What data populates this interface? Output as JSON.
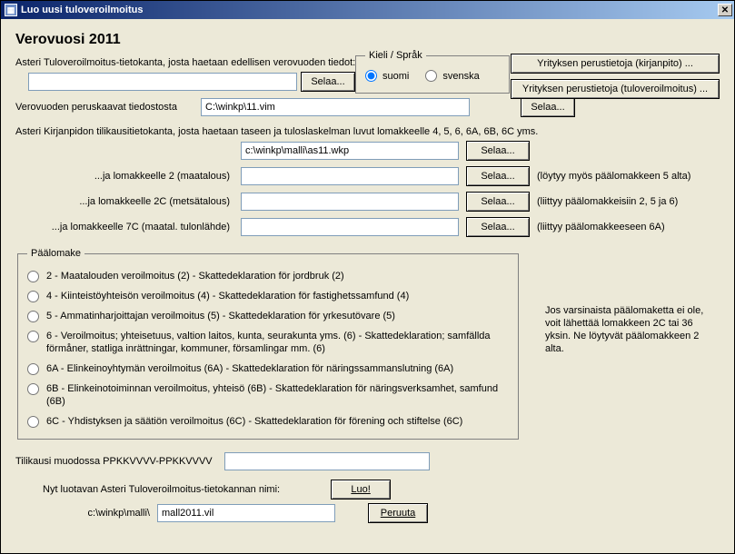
{
  "window": {
    "title": "Luo uusi tuloveroilmoitus"
  },
  "heading": "Verovuosi 2011",
  "buttons": {
    "company_kirjanpito": "Yrityksen perustietoja (kirjanpito) ...",
    "company_tulovero": "Yrityksen perustietoja (tuloveroilmoitus) ...",
    "browse": "Selaa...",
    "create": "Luo!",
    "cancel": "Peruuta"
  },
  "lang": {
    "legend": "Kieli / Språk",
    "fi": "suomi",
    "sv": "svenska"
  },
  "db": {
    "prev_label": "Asteri Tuloveroilmoitus-tietokanta, josta haetaan edellisen verovuoden tiedot:",
    "prev_value": "",
    "formulas_label": "Verovuoden peruskaavat tiedostosta",
    "formulas_value": "C:\\winkp\\11.vim",
    "kirjanpito_label": "Asteri Kirjanpidon tilikausitietokanta, josta haetaan taseen ja tuloslaskelman luvut lomakkeelle 4, 5, 6, 6A, 6B, 6C yms.",
    "kirjanpito_value": "c:\\winkp\\malli\\as11.wkp",
    "f2_label": "...ja lomakkeelle 2 (maatalous)",
    "f2_value": "",
    "f2_hint": "(löytyy myös päälomakkeen 5 alta)",
    "f2c_label": "...ja lomakkeelle 2C (metsätalous)",
    "f2c_value": "",
    "f2c_hint": "(liittyy päälomakkeisiin 2, 5 ja 6)",
    "f7c_label": "...ja lomakkeelle 7C (maatal. tulonlähde)",
    "f7c_value": "",
    "f7c_hint": "(liittyy päälomakkeeseen 6A)"
  },
  "mainform": {
    "legend": "Päälomake",
    "options": {
      "o2": "2 - Maatalouden veroilmoitus (2) - Skattedeklaration för jordbruk (2)",
      "o4": "4 - Kiinteistöyhteisön veroilmoitus (4) - Skattedeklaration för fastighetssamfund (4)",
      "o5": "5 - Ammatinharjoittajan veroilmoitus (5) - Skattedeklaration för yrkesutövare (5)",
      "o6": "6 - Veroilmoitus; yhteisetuus, valtion laitos, kunta, seurakunta yms. (6) - Skattedeklaration; samfällda förmåner, statliga inrättningar, kommuner, församlingar mm. (6)",
      "o6a": "6A - Elinkeinoyhtymän veroilmoitus (6A) - Skattedeklaration för näringssammanslutning (6A)",
      "o6b": "6B - Elinkeinotoiminnan veroilmoitus, yhteisö (6B) - Skattedeklaration för näringsverksamhet, samfund (6B)",
      "o6c": "6C - Yhdistyksen ja säätiön veroilmoitus (6C) - Skattedeklaration för förening och stiftelse (6C)"
    }
  },
  "sidenote": "Jos varsinaista päälomaketta ei ole, voit lähettää lomakkeen 2C tai 36 yksin. Ne löytyvät päälomakkeen 2 alta.",
  "tilikausi": {
    "label": "Tilikausi muodossa PPKKVVVV-PPKKVVVV",
    "value": ""
  },
  "newdb": {
    "label": "Nyt luotavan Asteri Tuloveroilmoitus-tietokannan nimi:",
    "path_label": "c:\\winkp\\malli\\",
    "filename": "mall2011.vil"
  }
}
